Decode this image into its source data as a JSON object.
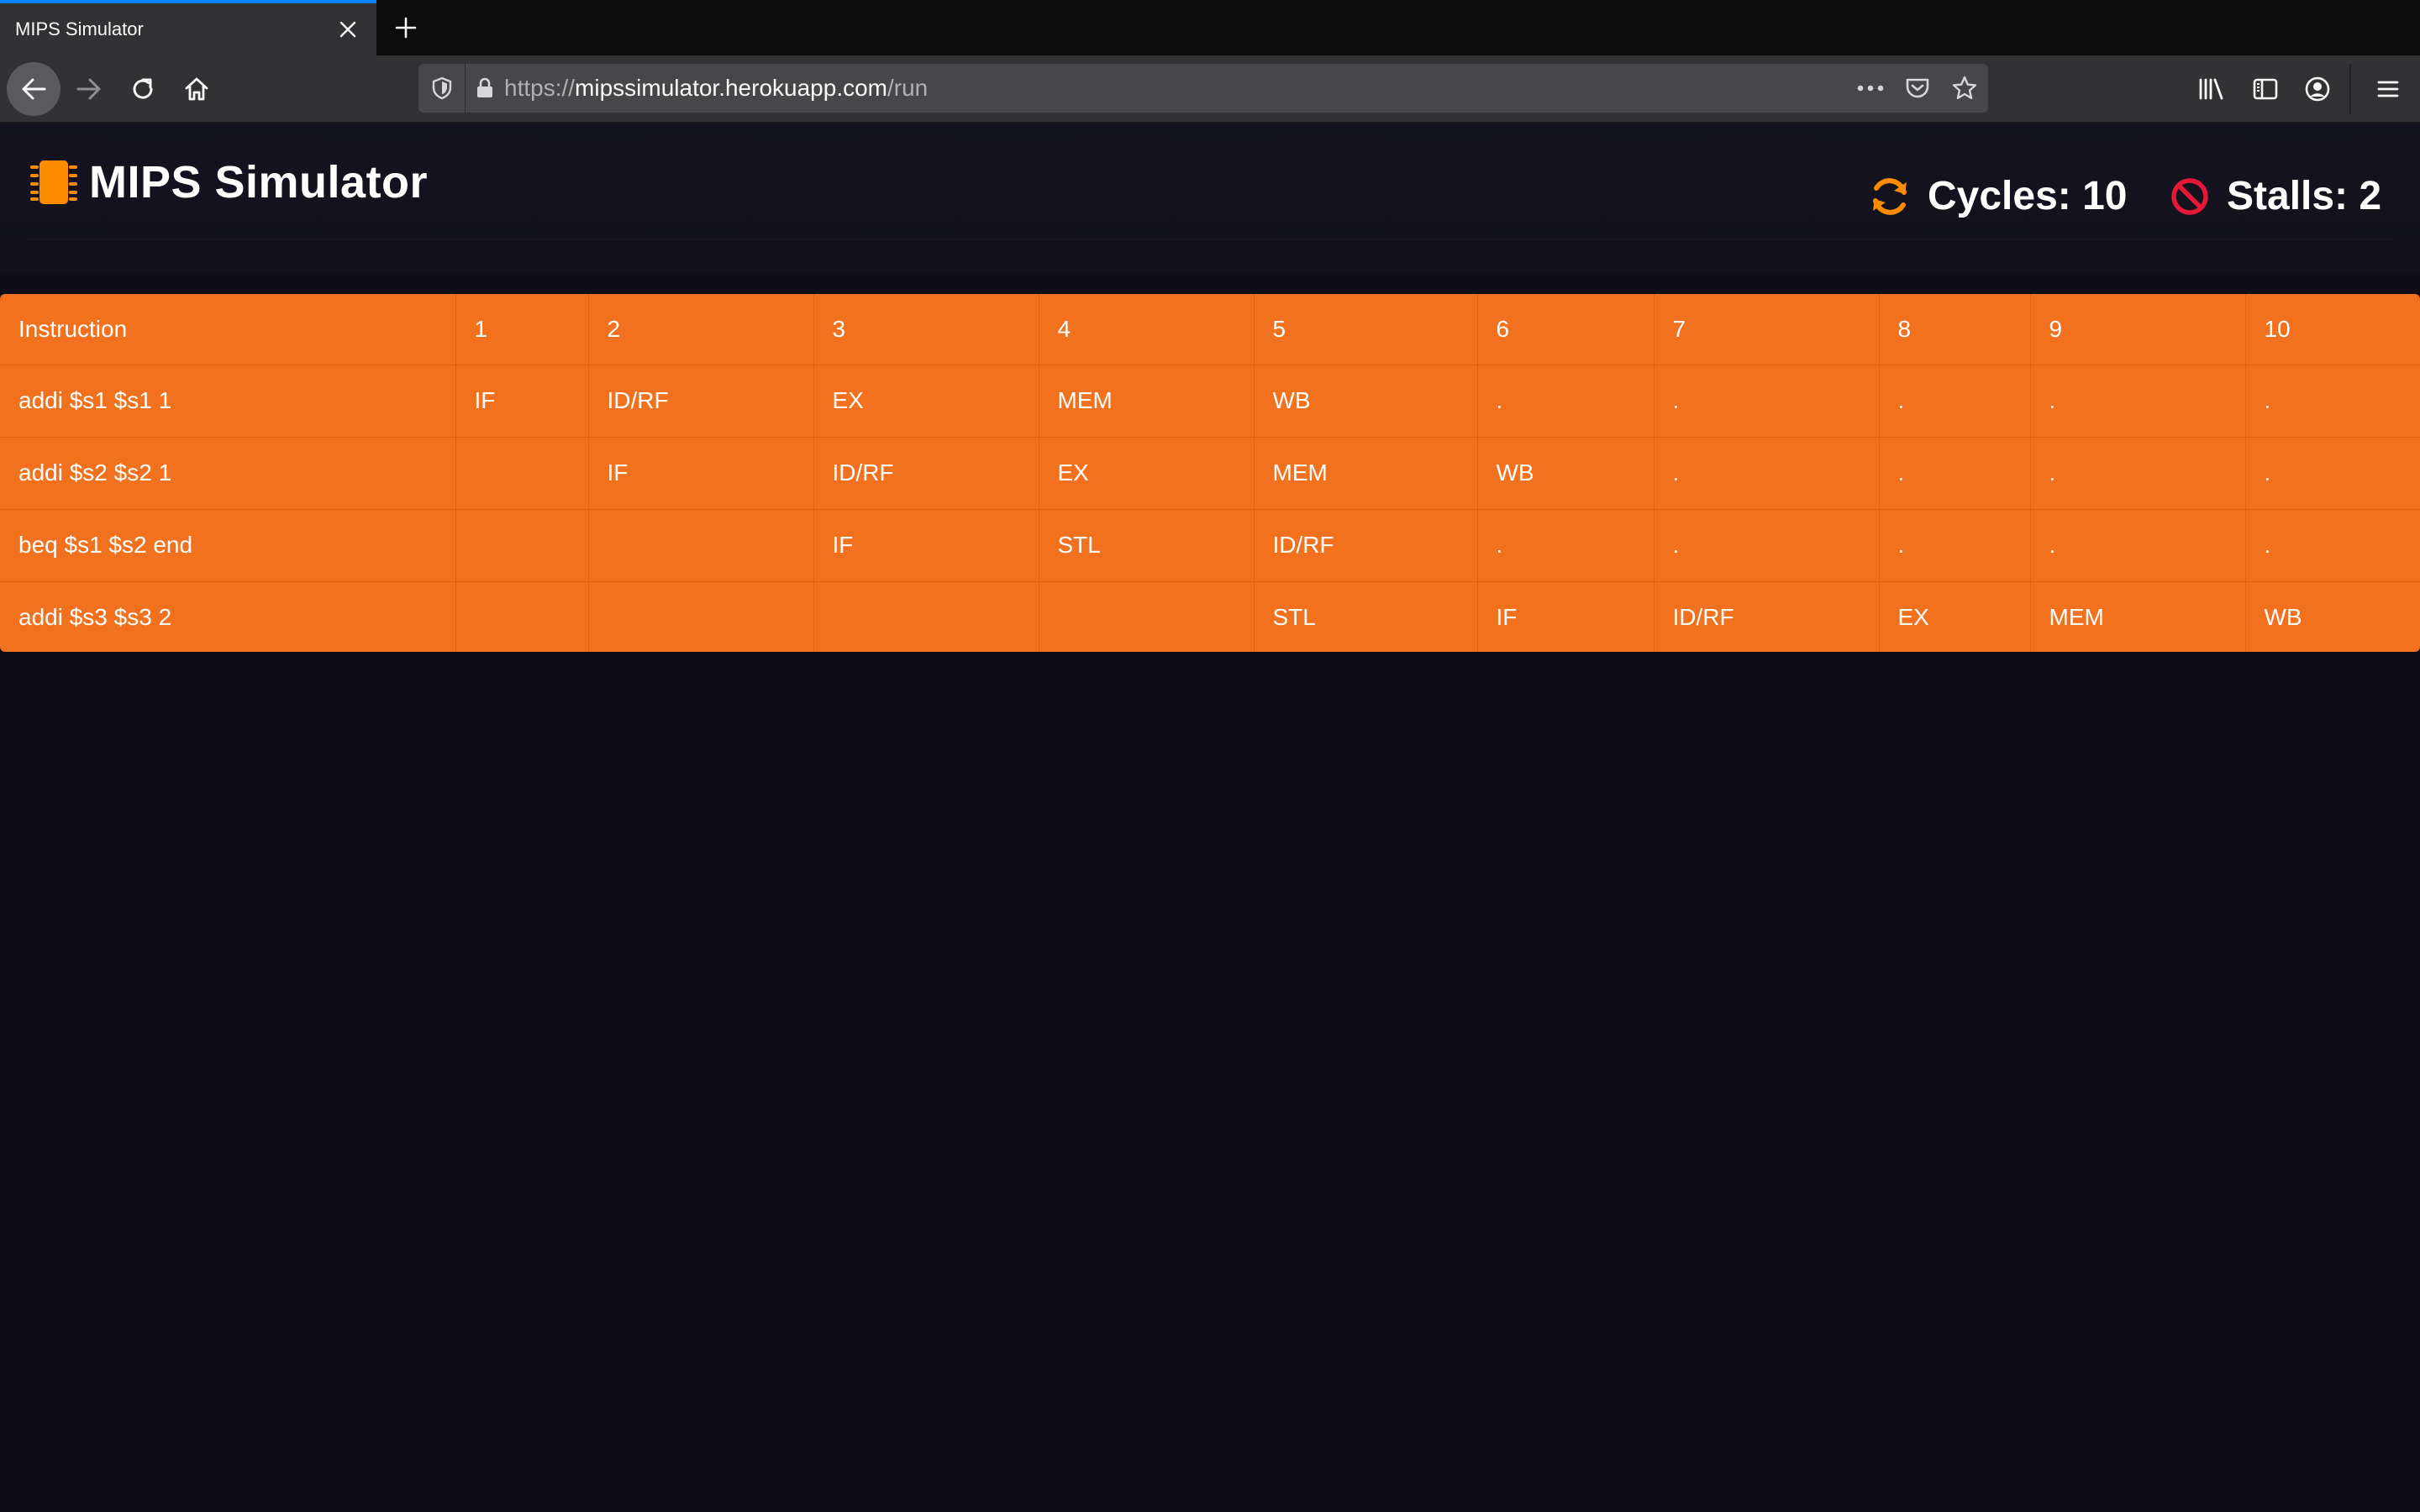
{
  "browser": {
    "tab_title": "MIPS Simulator",
    "url_scheme": "https://",
    "url_host": "mipssimulator.herokuapp.com",
    "url_path": "/run",
    "accent_color": "#0a84ff"
  },
  "header": {
    "title": "MIPS Simulator",
    "cycles_label": "Cycles: 10",
    "stalls_label": "Stalls: 2",
    "icons": {
      "brand": "microchip-icon",
      "cycles": "sync-icon",
      "stalls": "ban-icon"
    },
    "colors": {
      "brand_icon": "#ff8c00",
      "cycles_icon": "#ff8c00",
      "stalls_icon": "#e51937"
    }
  },
  "pipeline": {
    "background": "#f2711f",
    "columns": [
      "Instruction",
      "1",
      "2",
      "3",
      "4",
      "5",
      "6",
      "7",
      "8",
      "9",
      "10"
    ],
    "rows": [
      [
        "addi $s1 $s1 1",
        "IF",
        "ID/RF",
        "EX",
        "MEM",
        "WB",
        ".",
        ".",
        ".",
        ".",
        "."
      ],
      [
        "addi $s2 $s2 1",
        "",
        "IF",
        "ID/RF",
        "EX",
        "MEM",
        "WB",
        ".",
        ".",
        ".",
        "."
      ],
      [
        "beq $s1 $s2 end",
        "",
        "",
        "IF",
        "STL",
        "ID/RF",
        ".",
        ".",
        ".",
        ".",
        "."
      ],
      [
        "addi $s3 $s3 2",
        "",
        "",
        "",
        "",
        "STL",
        "IF",
        "ID/RF",
        "EX",
        "MEM",
        "WB"
      ]
    ]
  }
}
